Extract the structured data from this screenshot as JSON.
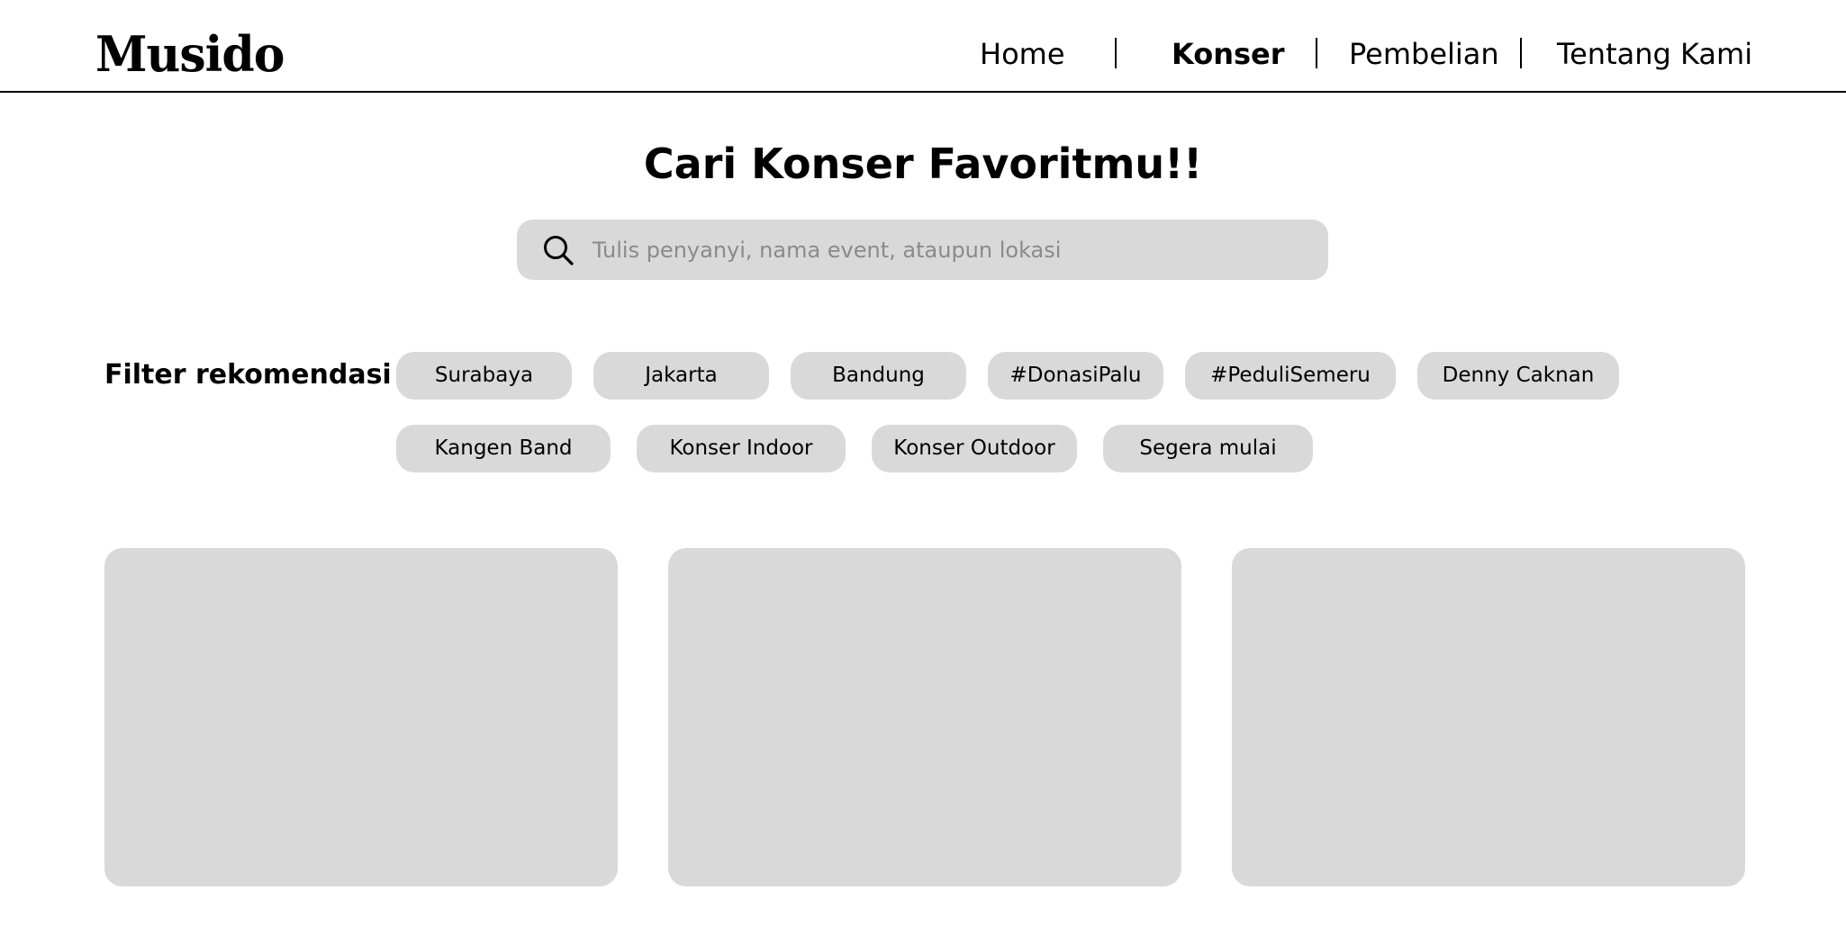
{
  "header": {
    "logo": "Musido",
    "nav": [
      {
        "label": "Home",
        "active": false
      },
      {
        "label": "Konser",
        "active": true
      },
      {
        "label": "Pembelian",
        "active": false
      },
      {
        "label": "Tentang Kami",
        "active": false
      }
    ]
  },
  "main": {
    "title": "Cari Konser Favoritmu!!",
    "search": {
      "placeholder": "Tulis penyanyi, nama event, ataupun lokasi",
      "value": "",
      "icon": "search-icon"
    },
    "filters": {
      "label": "Filter rekomendasi :",
      "chips": [
        "Surabaya",
        "Jakarta",
        "Bandung",
        "#DonasiPalu",
        "#PeduliSemeru",
        "Denny Caknan",
        "Kangen Band",
        "Konser Indoor",
        "Konser Outdoor",
        "Segera mulai"
      ]
    },
    "cards_count": 3
  },
  "colors": {
    "placeholder_fill": "#d9d9d9",
    "text": "#000000",
    "background": "#ffffff",
    "placeholder_text": "#8a8a8a"
  }
}
